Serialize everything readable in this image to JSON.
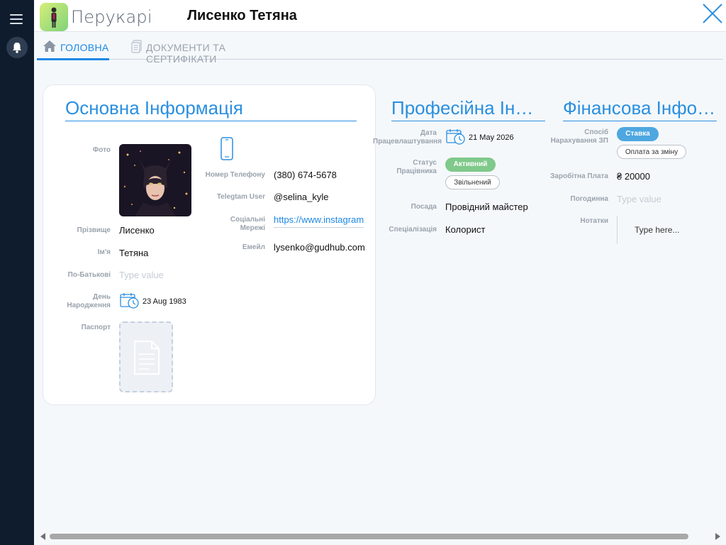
{
  "app": {
    "name": "Перукарі",
    "page_title": "Лисенко Тетяна"
  },
  "sidebar": {
    "menu_icon": "hamburger-icon",
    "notification_icon": "bell-icon"
  },
  "tabs": [
    {
      "label": "ГОЛОВНА",
      "icon": "home-icon",
      "active": true
    },
    {
      "label": "ДОКУМЕНТИ ТА СЕРТИФІКАТИ",
      "icon": "documents-icon",
      "active": false
    }
  ],
  "basic": {
    "title": "Основна Інформація",
    "photo_label": "Фото",
    "surname_label": "Прізвище",
    "surname": "Лисенко",
    "name_label": "Ім'я",
    "name": "Тетяна",
    "patronymic_label": "По-Батькові",
    "patronymic_placeholder": "Type value",
    "birthday_label_1": "День",
    "birthday_label_2": "Народження",
    "birthday": "23 Aug 1983",
    "passport_label": "Паспорт",
    "phone_icon": "phone-icon",
    "phone_label": "Номер Телефону",
    "phone": "(380) 674-5678",
    "telegram_label": "Telegtam User",
    "telegram": "@selina_kyle",
    "social_label_1": "Соціальні",
    "social_label_2": "Мережі",
    "social": "https://www.instagram.com",
    "email_label": "Емейл",
    "email": "lysenko@gudhub.com"
  },
  "professional": {
    "title": "Професійна Інформація",
    "employment_label_1": "Дата",
    "employment_label_2": "Працевлаштування",
    "employment_date": "21 May 2026",
    "status_label_1": "Статус",
    "status_label_2": "Працівника",
    "status_active": "Активний",
    "status_fired": "Звільнений",
    "position_label": "Посада",
    "position": "Провідний майстер",
    "specialization_label": "Спеціалізація",
    "specialization": "Колорист"
  },
  "financial": {
    "title": "Фінансова Інформація",
    "method_label_1": "Спосіб",
    "method_label_2": "Нарахування ЗП",
    "method_rate": "Ставка",
    "method_shift": "Оплата за зміну",
    "salary_label": "Заробітна Плата",
    "salary": "₴ 20000",
    "hourly_label": "Погодинна",
    "hourly_placeholder": "Type value",
    "notes_label": "Нотатки",
    "notes_placeholder": "Type here..."
  },
  "colors": {
    "accent": "#1e88e5",
    "active_status": "#7fc98a",
    "rate_chip": "#4ea7e0",
    "sidebar": "#0f1c2e"
  }
}
